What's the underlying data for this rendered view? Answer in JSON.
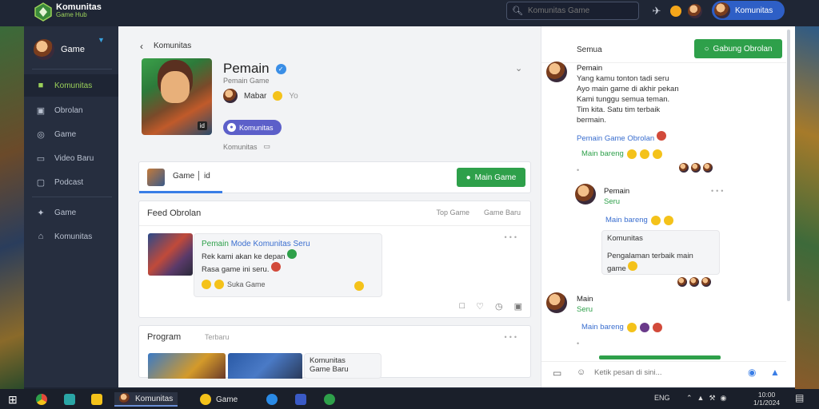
{
  "app": {
    "title": "Komunitas",
    "subtitle": "Game Hub"
  },
  "topbar": {
    "search_placeholder": "Komunitas Game",
    "user_name": "Komunitas"
  },
  "sidebar": {
    "user": "Game",
    "items": [
      {
        "label": "Komunitas",
        "icon": "folder-icon"
      },
      {
        "label": "Obrolan",
        "icon": "chat-icon"
      },
      {
        "label": "Game",
        "icon": "gamepad-icon"
      },
      {
        "label": "Video Baru",
        "icon": "video-icon"
      },
      {
        "label": "Podcast",
        "icon": "camera-icon"
      },
      {
        "label": "Game",
        "icon": "controller-icon"
      },
      {
        "label": "Komunitas",
        "icon": "home-icon"
      }
    ]
  },
  "main": {
    "breadcrumb": "Komunitas",
    "profile": {
      "name": "Pemain",
      "subtitle": "Pemain Game",
      "stat": "Mabar",
      "stat_extra": "Yo",
      "badge_label": "Komunitas",
      "hero_tag": "id",
      "footer": "Komunitas"
    },
    "tab": {
      "label": "Game",
      "extra": "id",
      "button": "Main Game"
    },
    "feed": {
      "title": "Feed Obrolan",
      "links": [
        "Top Game",
        "Game Baru"
      ],
      "post": {
        "author": "Pemain",
        "title": "Mode Komunitas Seru",
        "body_1": "Rek kami akan ke depan",
        "body_2": "Rasa game ini seru.",
        "reactions": "Suka Game"
      }
    },
    "programs": {
      "title": "Program",
      "subtitle": "Terbaru",
      "item_title": "Komunitas",
      "item_sub": "Game Baru"
    }
  },
  "right": {
    "header_label": "Semua",
    "join_button": "Gabung Obrolan",
    "messages": [
      {
        "name": "Pemain",
        "lines": [
          "Yang kamu tonton tadi seru",
          "Ayo main game di akhir pekan",
          "Kami tunggu semua teman.",
          "Tim kita. Satu tim terbaik",
          "bermain."
        ],
        "tag": "Pemain Game Obrolan",
        "reply": "Main bareng"
      },
      {
        "name": "Pemain",
        "sub": "Seru",
        "tag": "Main bareng",
        "bubble_1": "Komunitas",
        "bubble_2": "Pengalaman terbaik main game"
      },
      {
        "name": "Main",
        "sub": "Seru",
        "tag": "Main bareng"
      }
    ],
    "compose_placeholder": "Ketik pesan di sini..."
  },
  "taskbar": {
    "apps": [
      "Komunitas",
      "Game"
    ],
    "tray_label": "ENG",
    "time": "10:00",
    "date": "1/1/2024"
  },
  "colors": {
    "accent": "#2ea04a",
    "brand_blue": "#2e5fc6",
    "sidebar": "#262e3f",
    "topbar": "#1f2635"
  }
}
